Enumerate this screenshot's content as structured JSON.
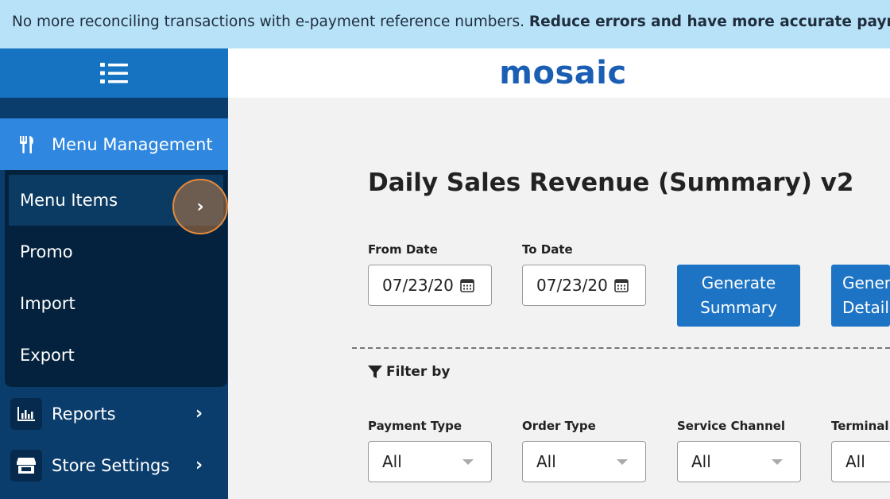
{
  "banner": {
    "text": "No more reconciling transactions with e-payment reference numbers. ",
    "bold_text": "Reduce errors and have more accurate payment data"
  },
  "header": {
    "logo": "mosaic"
  },
  "sidebar": {
    "menu_toggle_icon": "list-icon",
    "active_section": {
      "label": "Menu Management",
      "icon": "utensils-icon"
    },
    "submenu": [
      {
        "label": "Menu Items",
        "active": true,
        "icon": "chevron-right-icon"
      },
      {
        "label": "Promo"
      },
      {
        "label": "Import"
      },
      {
        "label": "Export"
      }
    ],
    "items": [
      {
        "label": "Reports",
        "icon": "bar-chart-icon"
      },
      {
        "label": "Store Settings",
        "icon": "store-icon"
      }
    ]
  },
  "main": {
    "title": "Daily Sales Revenue (Summary) v2",
    "from_date": {
      "label": "From Date",
      "value": "07/23/20"
    },
    "to_date": {
      "label": "To Date",
      "value": "07/23/20"
    },
    "buttons": {
      "generate_summary": "Generate Summary",
      "generate_details": "Generate Details"
    },
    "filter_title": "Filter by",
    "filters": [
      {
        "label": "Payment Type",
        "value": "All"
      },
      {
        "label": "Order Type",
        "value": "All"
      },
      {
        "label": "Service Channel",
        "value": "All"
      },
      {
        "label": "Terminal ID",
        "value": "All"
      }
    ]
  },
  "colors": {
    "banner_bg": "#b8e2f8",
    "sidebar_bg": "#0b3d6c",
    "accent": "#2f87e0",
    "button": "#1e74c4",
    "highlight": "#e58a3c"
  }
}
